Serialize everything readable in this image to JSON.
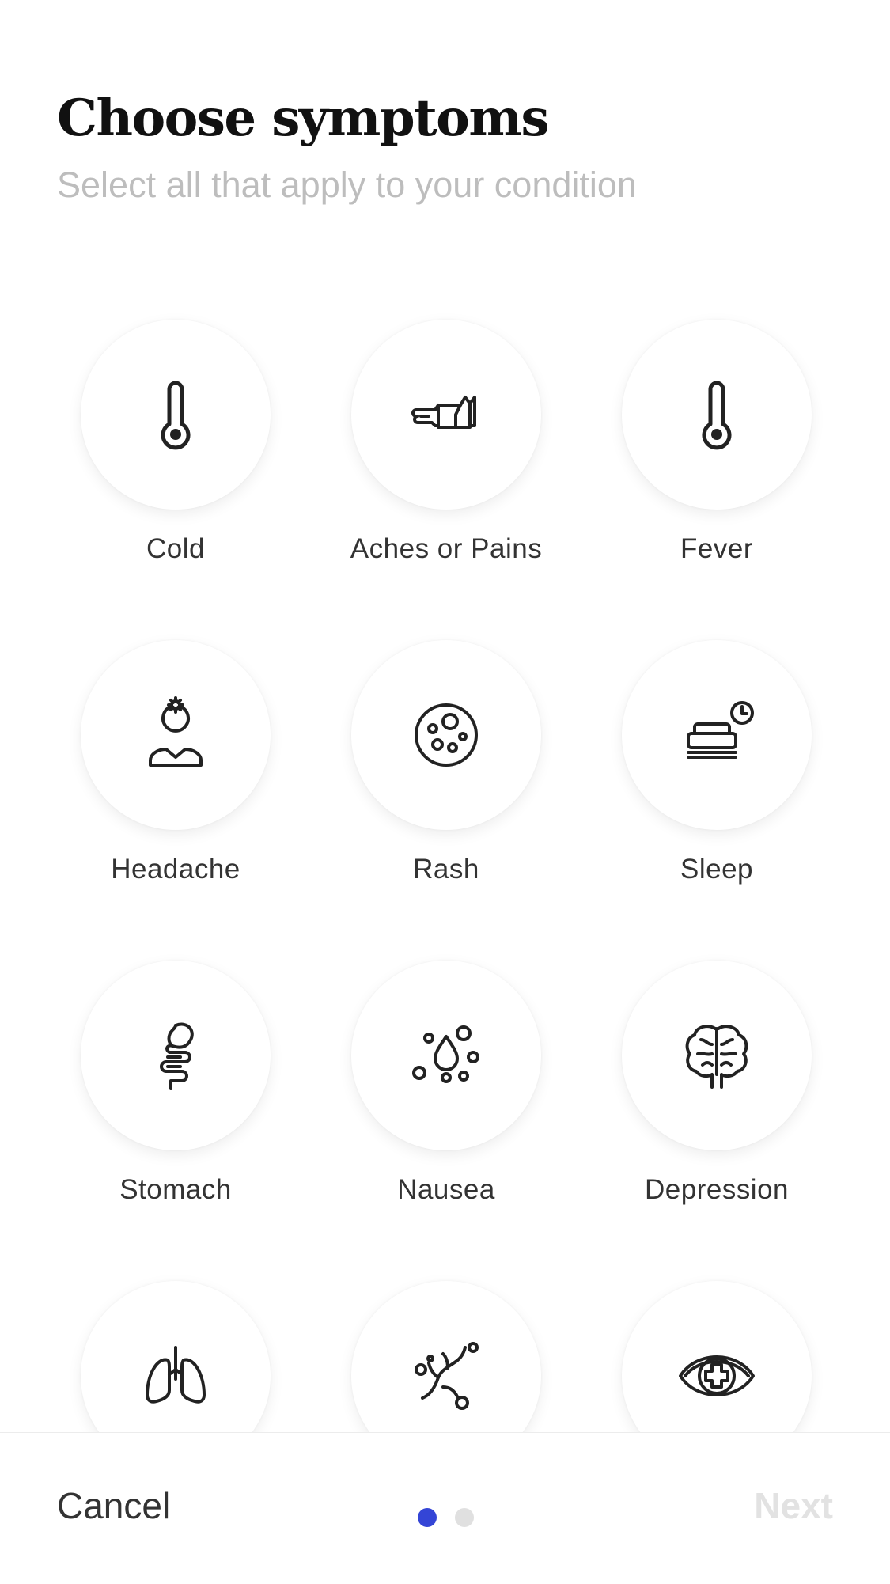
{
  "header": {
    "title": "Choose symptoms",
    "subtitle": "Select all that apply to your condition"
  },
  "symptoms": [
    {
      "label": "Cold",
      "icon": "thermometer-icon"
    },
    {
      "label": "Aches or Pains",
      "icon": "arm-cast-icon"
    },
    {
      "label": "Fever",
      "icon": "thermometer-icon"
    },
    {
      "label": "Headache",
      "icon": "headache-person-icon"
    },
    {
      "label": "Rash",
      "icon": "rash-spots-icon"
    },
    {
      "label": "Sleep",
      "icon": "bed-clock-icon"
    },
    {
      "label": "Stomach",
      "icon": "stomach-intestine-icon"
    },
    {
      "label": "Nausea",
      "icon": "nausea-drop-icon"
    },
    {
      "label": "Depression",
      "icon": "brain-icon"
    },
    {
      "label": "",
      "icon": "lungs-icon"
    },
    {
      "label": "",
      "icon": "allergy-branch-icon"
    },
    {
      "label": "",
      "icon": "eye-cross-icon"
    }
  ],
  "footer": {
    "cancel_label": "Cancel",
    "next_label": "Next",
    "page_current": 1,
    "page_total": 2
  },
  "colors": {
    "accent": "#3445d6",
    "dot_inactive": "#e0e0e0",
    "subtitle": "#bdbdbd",
    "next_disabled": "#e2e2e2"
  }
}
